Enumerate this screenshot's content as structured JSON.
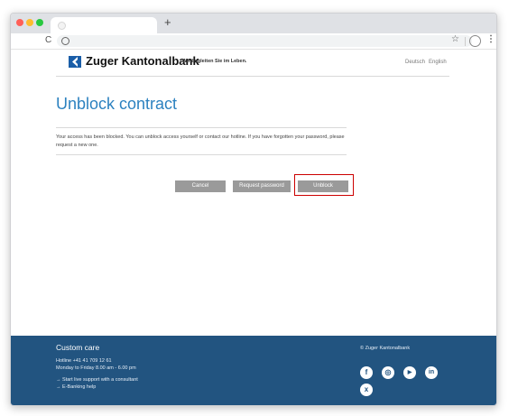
{
  "browser": {
    "new_tab": "+",
    "reload_glyph": "C",
    "star_glyph": "☆",
    "menu_glyph": "⋮",
    "traffic_lights": [
      "#ff5f57",
      "#febc2e",
      "#28c840"
    ]
  },
  "header": {
    "bank_name": "Zuger Kantonalbank",
    "tagline": "Wir begleiten Sie im Leben.",
    "languages": [
      "Deutsch",
      "English"
    ]
  },
  "main": {
    "title": "Unblock contract",
    "description": "Your access has been blocked. You can unblock access yourself or contact our hotline. If you have forgotten your password, please request a new one.",
    "buttons": {
      "cancel": "Cancel",
      "request_password": "Request password",
      "unblock": "Unblock"
    }
  },
  "footer": {
    "title": "Custom care",
    "hotline": "Hotline +41 41 709 12 61",
    "hours": "Monday to Friday 8.00 am - 6.00 pm",
    "link_support": "→ Start live support with a consultant",
    "link_help": "→ E-Banking help",
    "copyright": "© Zuger Kantonalbank",
    "social": [
      {
        "name": "facebook-icon",
        "glyph": "f"
      },
      {
        "name": "instagram-icon",
        "glyph": "◎"
      },
      {
        "name": "youtube-icon",
        "glyph": "▶"
      },
      {
        "name": "linkedin-icon",
        "glyph": "in"
      },
      {
        "name": "xing-icon",
        "glyph": "x"
      }
    ]
  },
  "colors": {
    "accent": "#2d82c0",
    "footer_bg": "#225480",
    "button_bg": "#9a9a9a",
    "highlight": "#cc0000"
  }
}
